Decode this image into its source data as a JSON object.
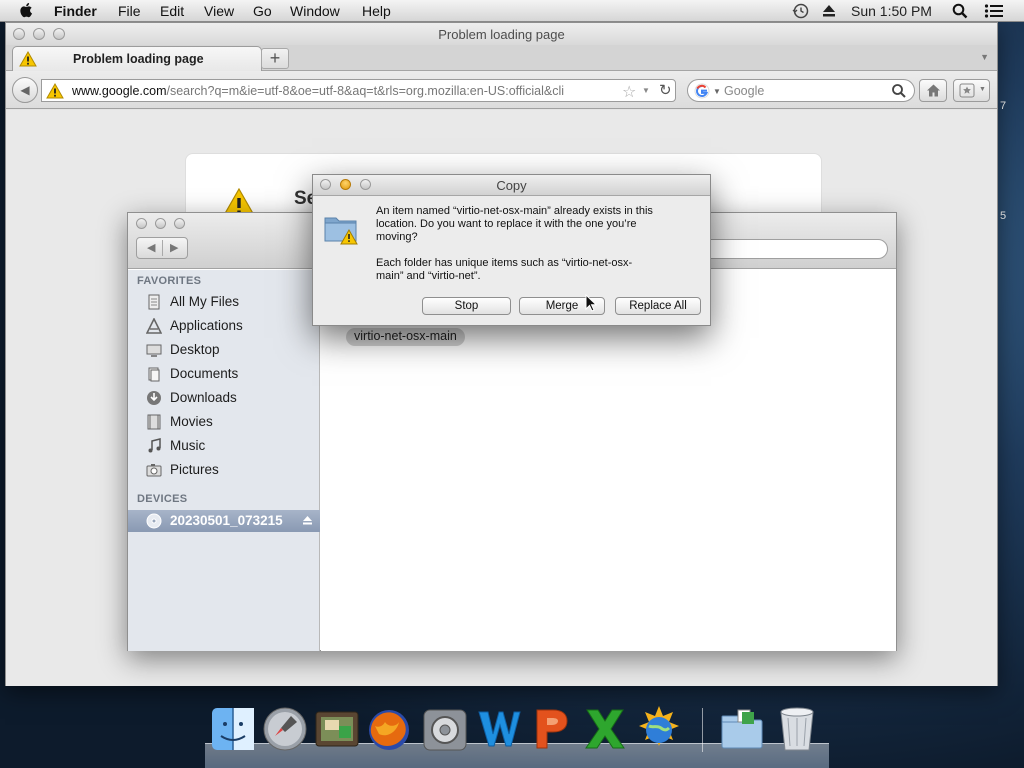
{
  "menubar": {
    "app_name": "Finder",
    "menus": [
      "File",
      "Edit",
      "View",
      "Go",
      "Window",
      "Help"
    ],
    "clock": "Sun 1:50 PM",
    "icons": [
      "apple-icon",
      "time-machine-icon",
      "eject-icon",
      "spotlight-icon",
      "notification-list-icon"
    ]
  },
  "firefox": {
    "window_title": "Problem loading page",
    "tab_label": "Problem loading page",
    "url_host": "www.google.com",
    "url_rest": "/search?q=m&ie=utf-8&oe=utf-8&aq=t&rls=org.mozilla:en-US:official&cli",
    "search_placeholder": "Google",
    "error_title_fragment": "Se"
  },
  "finder": {
    "sidebar": {
      "favorites_heading": "FAVORITES",
      "favorites": [
        {
          "label": "All My Files",
          "icon": "all-files-icon"
        },
        {
          "label": "Applications",
          "icon": "applications-icon"
        },
        {
          "label": "Desktop",
          "icon": "desktop-icon"
        },
        {
          "label": "Documents",
          "icon": "documents-icon"
        },
        {
          "label": "Downloads",
          "icon": "downloads-icon"
        },
        {
          "label": "Movies",
          "icon": "movies-icon"
        },
        {
          "label": "Music",
          "icon": "music-icon"
        },
        {
          "label": "Pictures",
          "icon": "pictures-icon"
        }
      ],
      "devices_heading": "DEVICES",
      "devices": [
        {
          "label": "20230501_073215",
          "icon": "disc-icon",
          "selected": true
        }
      ]
    },
    "file_item": "virtio-net-osx-main"
  },
  "copy_dialog": {
    "title": "Copy",
    "message_line1": "An item named “virtio-net-osx-main” already exists in this",
    "message_line2": "location. Do you want to replace it with the one you’re",
    "message_line3": "moving?",
    "detail_line1": "Each folder has unique items such as “virtio-net-osx-",
    "detail_line2": "main” and  “virtio-net”.",
    "buttons": {
      "stop": "Stop",
      "merge": "Merge",
      "replace_all": "Replace All"
    }
  },
  "dock": {
    "items": [
      "finder-icon",
      "launchpad-icon",
      "photo-browser-icon",
      "firefox-icon",
      "system-preferences-icon",
      "word-icon",
      "powerpoint-icon",
      "excel-icon",
      "network-globe-icon",
      "downloads-stack-icon",
      "trash-icon"
    ]
  },
  "desktop_edge": {
    "fragment_1": "7",
    "fragment_2": "5"
  }
}
